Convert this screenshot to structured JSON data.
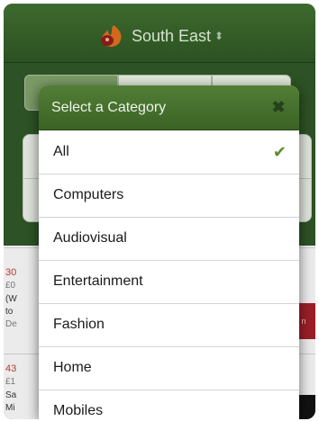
{
  "header": {
    "region_title": "South East",
    "region_icon": "flame-pin-icon",
    "sort_icon": "updown-chevron-icon"
  },
  "background_list": {
    "items": [
      {
        "line1": "30",
        "line2": "£0",
        "line3": "(W",
        "line4": "to",
        "line5": "De"
      },
      {
        "line1": "43",
        "line2": "£1",
        "line3": "Sa",
        "line4": "Mi"
      }
    ],
    "badge_text": "n"
  },
  "modal": {
    "title": "Select a Category",
    "close_icon": "close-icon",
    "selected_index": 0,
    "categories": [
      {
        "label": "All"
      },
      {
        "label": "Computers"
      },
      {
        "label": "Audiovisual"
      },
      {
        "label": "Entertainment"
      },
      {
        "label": "Fashion"
      },
      {
        "label": "Home"
      },
      {
        "label": "Mobiles"
      }
    ]
  },
  "colors": {
    "header_green": "#3e6a2e",
    "modal_header_green": "#527e36",
    "check_green": "#5f8c2c",
    "price_red": "#b9382f"
  }
}
